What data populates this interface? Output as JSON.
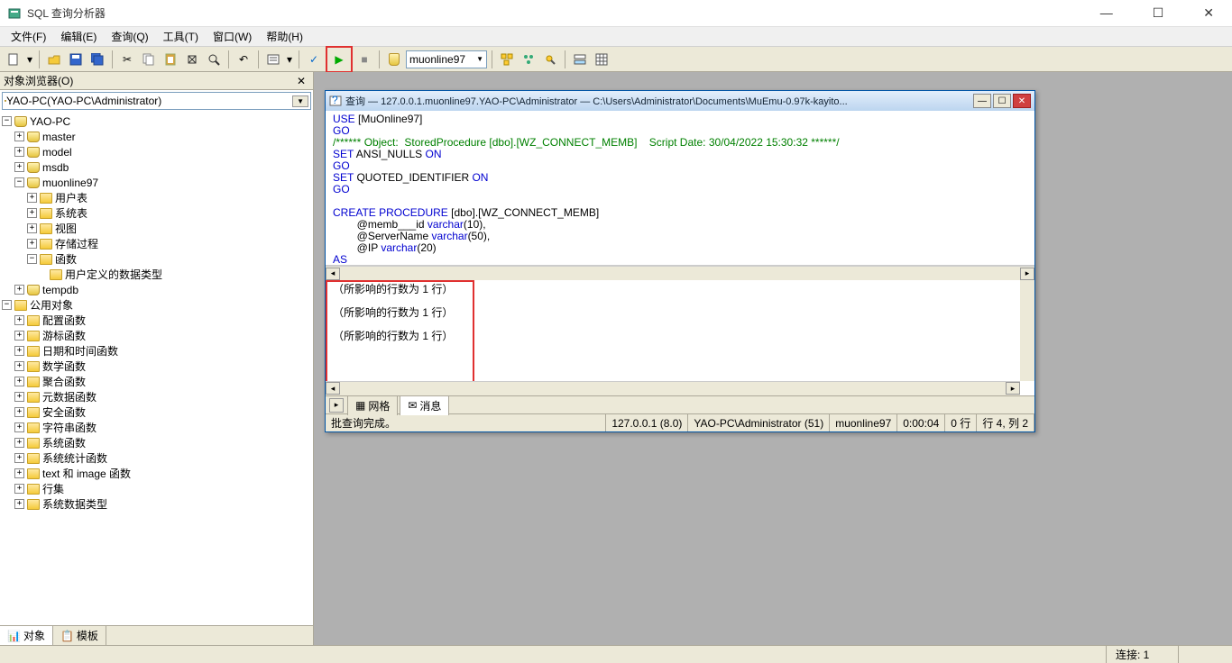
{
  "title_bar": {
    "title": "SQL 查询分析器"
  },
  "menu": {
    "file": "文件(F)",
    "edit": "编辑(E)",
    "query": "查询(Q)",
    "tools": "工具(T)",
    "window": "窗口(W)",
    "help": "帮助(H)"
  },
  "toolbar": {
    "db_combo": "muonline97"
  },
  "left_panel": {
    "title": "对象浏览器(O)",
    "server_combo": "YAO-PC(YAO-PC\\Administrator)",
    "root": "YAO-PC",
    "nodes": {
      "master": "master",
      "model": "model",
      "msdb": "msdb",
      "muonline": "muonline97",
      "mu_children": {
        "user_tables": "用户表",
        "sys_tables": "系统表",
        "views": "视图",
        "procs": "存储过程",
        "funcs": "函数",
        "types": "用户定义的数据类型"
      },
      "tempdb": "tempdb",
      "common": "公用对象",
      "co_children": {
        "config": "配置函数",
        "cursor": "游标函数",
        "datetime": "日期和时间函数",
        "math": "数学函数",
        "aggregate": "聚合函数",
        "meta": "元数据函数",
        "security": "安全函数",
        "string": "字符串函数",
        "system": "系统函数",
        "stats": "系统统计函数",
        "textimg": "text 和 image 函数",
        "rowset": "行集",
        "sysdt": "系统数据类型"
      }
    },
    "tabs": {
      "objects": "对象",
      "templates": "模板"
    }
  },
  "query_window": {
    "title": "查询 — 127.0.0.1.muonline97.YAO-PC\\Administrator — C:\\Users\\Administrator\\Documents\\MuEmu-0.97k-kayito...",
    "sql_lines": [
      {
        "t": "USE",
        "c": "kw"
      },
      {
        "t": " [MuOnline97]\n",
        "c": ""
      },
      {
        "t": "GO\n",
        "c": "kw"
      },
      {
        "t": "/****** Object:  StoredProcedure [dbo].[WZ_CONNECT_MEMB]    Script Date: 30/04/2022 15:30:32 ******/\n",
        "c": "cm"
      },
      {
        "t": "SET",
        "c": "kw"
      },
      {
        "t": " ANSI_NULLS ",
        "c": ""
      },
      {
        "t": "ON\n",
        "c": "kw"
      },
      {
        "t": "GO\n",
        "c": "kw"
      },
      {
        "t": "SET",
        "c": "kw"
      },
      {
        "t": " QUOTED_IDENTIFIER ",
        "c": ""
      },
      {
        "t": "ON\n",
        "c": "kw"
      },
      {
        "t": "GO\n",
        "c": "kw"
      },
      {
        "t": "\n",
        "c": ""
      },
      {
        "t": "CREATE PROCEDURE",
        "c": "kw"
      },
      {
        "t": " [dbo].[WZ_CONNECT_MEMB]\n",
        "c": ""
      },
      {
        "t": "        @memb___id ",
        "c": ""
      },
      {
        "t": "varchar",
        "c": "kw"
      },
      {
        "t": "(10),\n",
        "c": ""
      },
      {
        "t": "        @ServerName ",
        "c": ""
      },
      {
        "t": "varchar",
        "c": "kw"
      },
      {
        "t": "(50),\n",
        "c": ""
      },
      {
        "t": "        @IP ",
        "c": ""
      },
      {
        "t": "varchar",
        "c": "kw"
      },
      {
        "t": "(20)\n",
        "c": ""
      },
      {
        "t": "AS",
        "c": "kw"
      }
    ],
    "results": {
      "line1": "（所影响的行数为 1 行）",
      "line2": "（所影响的行数为 1 行）",
      "line3": "（所影响的行数为 1 行）"
    },
    "result_tabs": {
      "grid": "网格",
      "messages": "消息"
    },
    "status": {
      "msg": "批查询完成。",
      "server": "127.0.0.1 (8.0)",
      "user": "YAO-PC\\Administrator (51)",
      "db": "muonline97",
      "elapsed": "0:00:04",
      "rows": "0 行",
      "pos": "行 4, 列 2"
    }
  },
  "app_status": {
    "connections": "连接: 1"
  }
}
